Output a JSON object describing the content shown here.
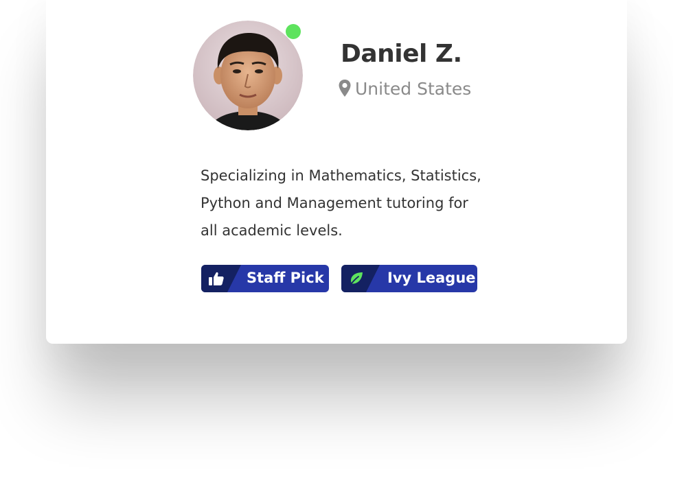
{
  "profile": {
    "name": "Daniel Z.",
    "location": "United States",
    "online": true,
    "bio": "Specializing in Mathematics, Statistics, Python and Management tutoring for all academic levels."
  },
  "badges": [
    {
      "label": "Staff Pick",
      "icon": "thumbs-up-icon"
    },
    {
      "label": "Ivy League",
      "icon": "leaf-icon"
    }
  ],
  "colors": {
    "badge_bg": "#2738a8",
    "badge_cap": "#142162",
    "online": "#5ee35e",
    "leaf": "#5ee35e",
    "name": "#333333",
    "location": "#8a8a8a"
  }
}
